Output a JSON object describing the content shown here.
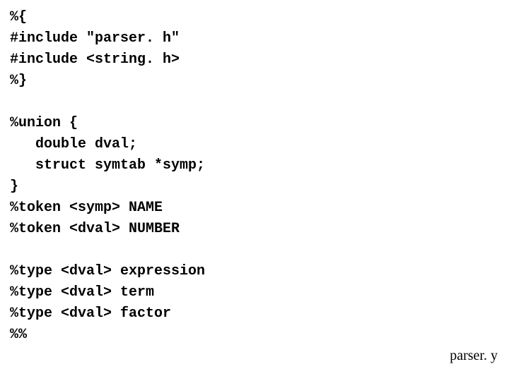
{
  "code_lines": [
    "%{",
    "#include \"parser. h\"",
    "#include <string. h>",
    "%}",
    "",
    "%union {",
    "   double dval;",
    "   struct symtab *symp;",
    "}",
    "%token <symp> NAME",
    "%token <dval> NUMBER",
    "",
    "%type <dval> expression",
    "%type <dval> term",
    "%type <dval> factor",
    "%%"
  ],
  "footer_label": "parser. y"
}
